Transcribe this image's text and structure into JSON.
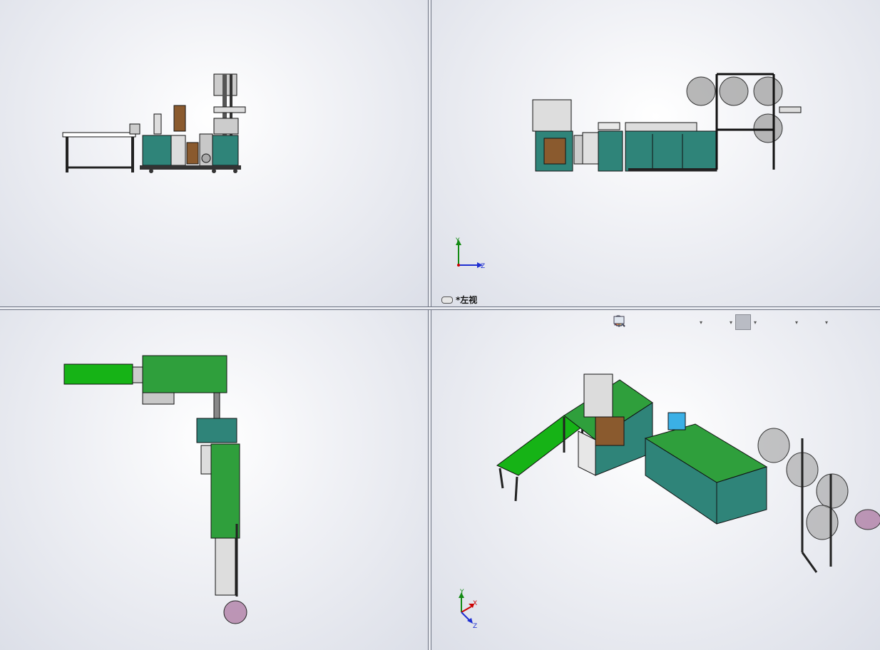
{
  "viewports": {
    "top_left": {
      "name": "front-view"
    },
    "top_right": {
      "name": "left-view",
      "label": "*左视"
    },
    "bottom_left": {
      "name": "top-view"
    },
    "bottom_right": {
      "name": "isometric-view"
    }
  },
  "triad": {
    "y": "Y",
    "z": "Z",
    "x": "X"
  },
  "colors": {
    "cabinet": "#2f8479",
    "frame": "#1c1c1c",
    "conveyor_green": "#16b316",
    "plate_green": "#2f9f3c",
    "reel": "#a0a0a0",
    "reel_pink": "#b07fa6",
    "brown": "#8a5a2e"
  },
  "toolbar": {
    "items": [
      "zoom-to-fit-icon",
      "zoom-to-area-icon",
      "previous-view-icon",
      "section-view-icon",
      "view-orientation-icon",
      "display-style-icon",
      "hide-show-items-icon",
      "edit-appearance-icon",
      "apply-scene-icon",
      "view-settings-icon"
    ]
  }
}
